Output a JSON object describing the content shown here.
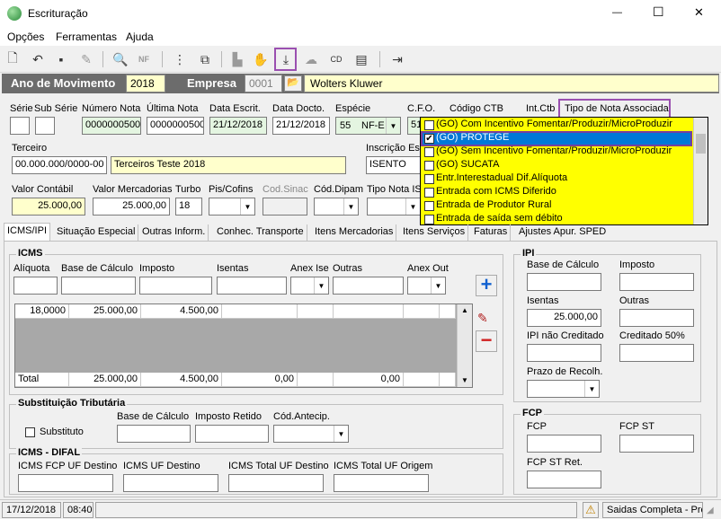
{
  "window": {
    "title": "Escrituração",
    "minimize": "—",
    "maximize": "☐",
    "close": "✕"
  },
  "menu": [
    "Opções",
    "Ferramentas",
    "Ajuda"
  ],
  "movimento": {
    "ano_label": "Ano de Movimento",
    "ano_value": "2018",
    "empresa_label": "Empresa",
    "empresa_code": "0001",
    "empresa_name": "Wolters Kluwer"
  },
  "fields": {
    "serie_label": "Série",
    "subserie_label": "Sub Série",
    "numero_nota_label": "Número Nota",
    "numero_nota_value": "0000000500",
    "ultima_nota_label": "Última Nota",
    "ultima_nota_value": "0000000500",
    "data_escrit_label": "Data Escrit.",
    "data_escrit_value": "21/12/2018",
    "data_docto_label": "Data Docto.",
    "data_docto_value": "21/12/2018",
    "especie_label": "Espécie",
    "especie_code": "55",
    "especie_value": "NF-E",
    "cfo_label": "C.F.O.",
    "cfo_value": "51",
    "codigo_ctb_label": "Código CTB",
    "int_ctb_label": "Int.Ctb",
    "tipo_nota_label": "Tipo de Nota Associada",
    "terceiro_label": "Terceiro",
    "terceiro_doc": "00.000.000/0000-00",
    "terceiro_name": "Terceiros Teste 2018",
    "inscricao_label": "Inscrição Est",
    "inscricao_value": "ISENTO",
    "valor_contabil_label": "Valor Contábil",
    "valor_contabil_value": "25.000,00",
    "valor_merc_label": "Valor Mercadorias",
    "valor_merc_value": "25.000,00",
    "turbo_label": "Turbo",
    "turbo_value": "18",
    "pis_label": "Pis/Cofins",
    "cod_sinac_label": "Cod.Sinac",
    "cod_dipam_label": "Cód.Dipam",
    "tipo_nota_is_label": "Tipo Nota IS"
  },
  "dropdown": [
    {
      "label": "(GO) Com Incentivo Fomentar/Produzir/MicroProduzir",
      "checked": false
    },
    {
      "label": "(GO) PROTEGE",
      "checked": true
    },
    {
      "label": "(GO) Sem Incentivo Fomentar/Produzir/MicroProduzir",
      "checked": false
    },
    {
      "label": "(GO) SUCATA",
      "checked": false
    },
    {
      "label": "Entr.Interestadual Dif.Alíquota",
      "checked": false
    },
    {
      "label": "Entrada com ICMS Diferido",
      "checked": false
    },
    {
      "label": "Entrada de Produtor Rural",
      "checked": false
    },
    {
      "label": "Entrada de saída sem débito",
      "checked": false
    }
  ],
  "tabs": [
    "ICMS/IPI",
    "Situação Especial",
    "Outras Inform.",
    "Conhec. Transporte",
    "Itens Mercadorias",
    "Itens Serviços",
    "Faturas",
    "Ajustes Apur. SPED"
  ],
  "icms": {
    "title": "ICMS",
    "aliquota": "Alíquota",
    "base": "Base de Cálculo",
    "imposto": "Imposto",
    "isentas": "Isentas",
    "anex_ise": "Anex Ise",
    "outras": "Outras",
    "anex_out": "Anex Out",
    "row": [
      "18,0000",
      "25.000,00",
      "4.500,00",
      "",
      "",
      "",
      "",
      ""
    ],
    "total": [
      "Total",
      "25.000,00",
      "4.500,00",
      "0,00",
      "",
      "0,00",
      "",
      ""
    ]
  },
  "st": {
    "title": "Substituição Tributária",
    "substituto": "Substituto",
    "base": "Base de Cálculo",
    "imposto_retido": "Imposto Retido",
    "cod_antecip": "Cód.Antecip."
  },
  "difal": {
    "title": "ICMS - DIFAL",
    "fcp_uf": "ICMS FCP UF Destino",
    "uf_destino": "ICMS UF Destino",
    "total_uf_destino": "ICMS Total UF Destino",
    "total_uf_origem": "ICMS Total UF Origem"
  },
  "ipi": {
    "title": "IPI",
    "base": "Base de Cálculo",
    "imposto": "Imposto",
    "isentas": "Isentas",
    "isentas_value": "25.000,00",
    "outras": "Outras",
    "nao_creditado": "IPI não Creditado",
    "creditado50": "Creditado 50%",
    "prazo": "Prazo de Recolh."
  },
  "fcp": {
    "title": "FCP",
    "fcp": "FCP",
    "fcp_st": "FCP ST",
    "fcp_st_ret": "FCP ST Ret."
  },
  "status": {
    "date": "17/12/2018",
    "time": "08:40",
    "mode": "Saidas Completa - Pros"
  },
  "colors": {
    "dark_bar": "#6c6c6c",
    "dropdown_bg": "#ffff00",
    "selected": "#0078d7",
    "highlight": "#9a4fb0"
  }
}
